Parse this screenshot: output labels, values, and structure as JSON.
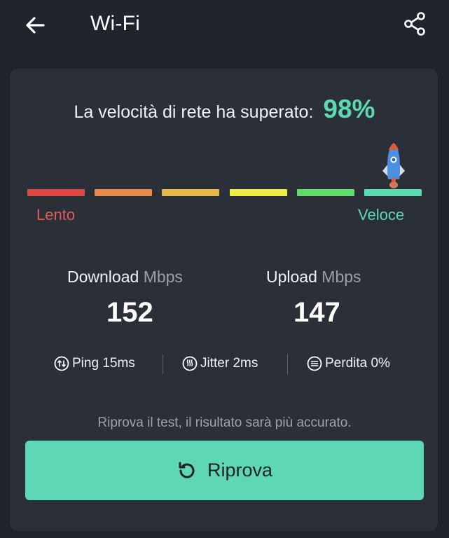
{
  "header": {
    "title": "Wi-Fi",
    "back_icon": "arrow-left-icon",
    "share_icon": "share-icon"
  },
  "result": {
    "headline": "La velocità di rete ha superato:",
    "percentage": "98%",
    "percentage_value": 0.98,
    "accent_color": "#5ddbb0",
    "indicator_icon": "rocket-icon"
  },
  "scale": {
    "slow_label": "Lento",
    "fast_label": "Veloce",
    "slow_color": "#e05a5a",
    "fast_color": "#5ddbb0",
    "segment_colors": [
      "#e04848",
      "#e8884a",
      "#e9b84a",
      "#f0ec4a",
      "#5fdc6a",
      "#5ddbb0"
    ]
  },
  "download": {
    "label": "Download",
    "unit": "Mbps",
    "value": "152"
  },
  "upload": {
    "label": "Upload",
    "unit": "Mbps",
    "value": "147"
  },
  "stats": [
    {
      "icon": "ping-icon",
      "label": "Ping 15ms"
    },
    {
      "icon": "jitter-icon",
      "label": "Jitter 2ms"
    },
    {
      "icon": "packet-loss-icon",
      "label": "Perdita 0%"
    }
  ],
  "hint": "Riprova il test, il risultato sarà più accurato.",
  "retry_button": {
    "label": "Riprova",
    "icon": "refresh-icon",
    "color": "#5ed8b4"
  }
}
